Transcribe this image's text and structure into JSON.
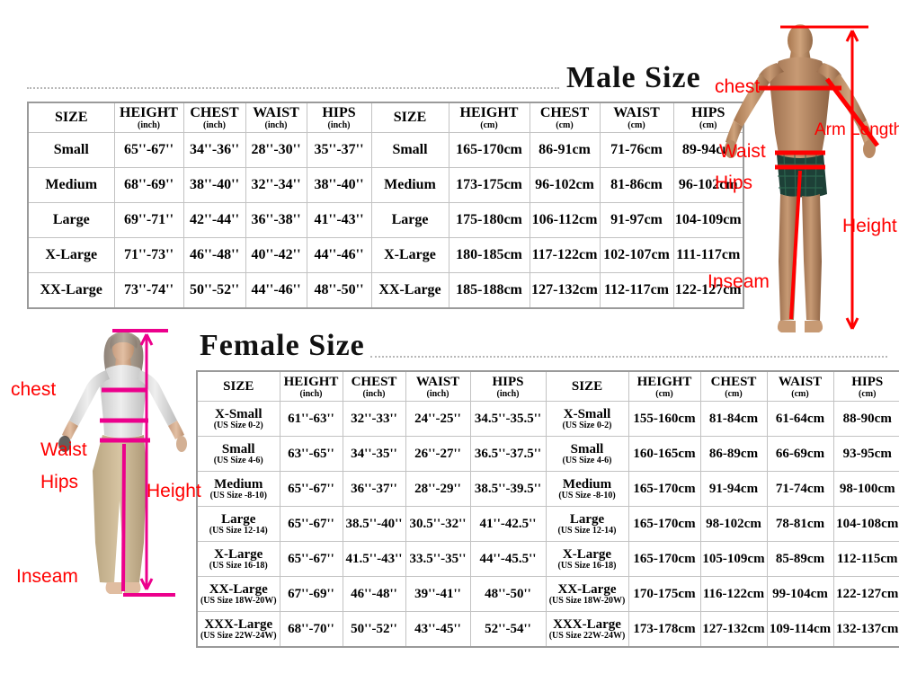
{
  "male": {
    "title": "Male Size",
    "headers_inch": [
      {
        "label": "SIZE",
        "unit": ""
      },
      {
        "label": "HEIGHT",
        "unit": "(inch)"
      },
      {
        "label": "CHEST",
        "unit": "(inch)"
      },
      {
        "label": "WAIST",
        "unit": "(inch)"
      },
      {
        "label": "HIPS",
        "unit": "(inch)"
      }
    ],
    "headers_cm": [
      {
        "label": "SIZE",
        "unit": ""
      },
      {
        "label": "HEIGHT",
        "unit": "(cm)"
      },
      {
        "label": "CHEST",
        "unit": "(cm)"
      },
      {
        "label": "WAIST",
        "unit": "(cm)"
      },
      {
        "label": "HIPS",
        "unit": "(cm)"
      }
    ],
    "rows": [
      {
        "size": "Small",
        "height_in": "65''-67''",
        "chest_in": "34''-36''",
        "waist_in": "28''-30''",
        "hips_in": "35''-37''",
        "height_cm": "165-170cm",
        "chest_cm": "86-91cm",
        "waist_cm": "71-76cm",
        "hips_cm": "89-94cm"
      },
      {
        "size": "Medium",
        "height_in": "68''-69''",
        "chest_in": "38''-40''",
        "waist_in": "32''-34''",
        "hips_in": "38''-40''",
        "height_cm": "173-175cm",
        "chest_cm": "96-102cm",
        "waist_cm": "81-86cm",
        "hips_cm": "96-102cm"
      },
      {
        "size": "Large",
        "height_in": "69''-71''",
        "chest_in": "42''-44''",
        "waist_in": "36''-38''",
        "hips_in": "41''-43''",
        "height_cm": "175-180cm",
        "chest_cm": "106-112cm",
        "waist_cm": "91-97cm",
        "hips_cm": "104-109cm"
      },
      {
        "size": "X-Large",
        "height_in": "71''-73''",
        "chest_in": "46''-48''",
        "waist_in": "40''-42''",
        "hips_in": "44''-46''",
        "height_cm": "180-185cm",
        "chest_cm": "117-122cm",
        "waist_cm": "102-107cm",
        "hips_cm": "111-117cm"
      },
      {
        "size": "XX-Large",
        "height_in": "73''-74''",
        "chest_in": "50''-52''",
        "waist_in": "44''-46''",
        "hips_in": "48''-50''",
        "height_cm": "185-188cm",
        "chest_cm": "127-132cm",
        "waist_cm": "112-117cm",
        "hips_cm": "122-127cm"
      }
    ],
    "annotations": {
      "chest": "chest",
      "waist": "Waist",
      "hips": "Hips",
      "inseam": "Inseam",
      "height": "Height",
      "arm_length": "Arm Length"
    },
    "line_color": "#ff0000"
  },
  "female": {
    "title": "Female Size",
    "headers_inch": [
      {
        "label": "SIZE",
        "unit": ""
      },
      {
        "label": "HEIGHT",
        "unit": "(inch)"
      },
      {
        "label": "CHEST",
        "unit": "(inch)"
      },
      {
        "label": "WAIST",
        "unit": "(inch)"
      },
      {
        "label": "HIPS",
        "unit": "(inch)"
      }
    ],
    "headers_cm": [
      {
        "label": "SIZE",
        "unit": ""
      },
      {
        "label": "HEIGHT",
        "unit": "(cm)"
      },
      {
        "label": "CHEST",
        "unit": "(cm)"
      },
      {
        "label": "WAIST",
        "unit": "(cm)"
      },
      {
        "label": "HIPS",
        "unit": "(cm)"
      }
    ],
    "rows": [
      {
        "size": "X-Small",
        "us_size": "(US Size 0-2)",
        "height_in": "61''-63''",
        "chest_in": "32''-33''",
        "waist_in": "24''-25''",
        "hips_in": "34.5''-35.5''",
        "height_cm": "155-160cm",
        "chest_cm": "81-84cm",
        "waist_cm": "61-64cm",
        "hips_cm": "88-90cm"
      },
      {
        "size": "Small",
        "us_size": "(US Size 4-6)",
        "height_in": "63''-65''",
        "chest_in": "34''-35''",
        "waist_in": "26''-27''",
        "hips_in": "36.5''-37.5''",
        "height_cm": "160-165cm",
        "chest_cm": "86-89cm",
        "waist_cm": "66-69cm",
        "hips_cm": "93-95cm"
      },
      {
        "size": "Medium",
        "us_size": "(US Size -8-10)",
        "height_in": "65''-67''",
        "chest_in": "36''-37''",
        "waist_in": "28''-29''",
        "hips_in": "38.5''-39.5''",
        "height_cm": "165-170cm",
        "chest_cm": "91-94cm",
        "waist_cm": "71-74cm",
        "hips_cm": "98-100cm"
      },
      {
        "size": "Large",
        "us_size": "(US Size 12-14)",
        "height_in": "65''-67''",
        "chest_in": "38.5''-40''",
        "waist_in": "30.5''-32''",
        "hips_in": "41''-42.5''",
        "height_cm": "165-170cm",
        "chest_cm": "98-102cm",
        "waist_cm": "78-81cm",
        "hips_cm": "104-108cm"
      },
      {
        "size": "X-Large",
        "us_size": "(US Size 16-18)",
        "height_in": "65''-67''",
        "chest_in": "41.5''-43''",
        "waist_in": "33.5''-35''",
        "hips_in": "44''-45.5''",
        "height_cm": "165-170cm",
        "chest_cm": "105-109cm",
        "waist_cm": "85-89cm",
        "hips_cm": "112-115cm"
      },
      {
        "size": "XX-Large",
        "us_size": "(US Size 18W-20W)",
        "height_in": "67''-69''",
        "chest_in": "46''-48''",
        "waist_in": "39''-41''",
        "hips_in": "48''-50''",
        "height_cm": "170-175cm",
        "chest_cm": "116-122cm",
        "waist_cm": "99-104cm",
        "hips_cm": "122-127cm"
      },
      {
        "size": "XXX-Large",
        "us_size": "(US Size 22W-24W)",
        "height_in": "68''-70''",
        "chest_in": "50''-52''",
        "waist_in": "43''-45''",
        "hips_in": "52''-54''",
        "height_cm": "173-178cm",
        "chest_cm": "127-132cm",
        "waist_cm": "109-114cm",
        "hips_cm": "132-137cm"
      }
    ],
    "annotations": {
      "chest": "chest",
      "waist": "Waist",
      "hips": "Hips",
      "inseam": "Inseam",
      "height": "Height"
    },
    "line_color": "#ec008c",
    "label_color": "#ff0000"
  }
}
